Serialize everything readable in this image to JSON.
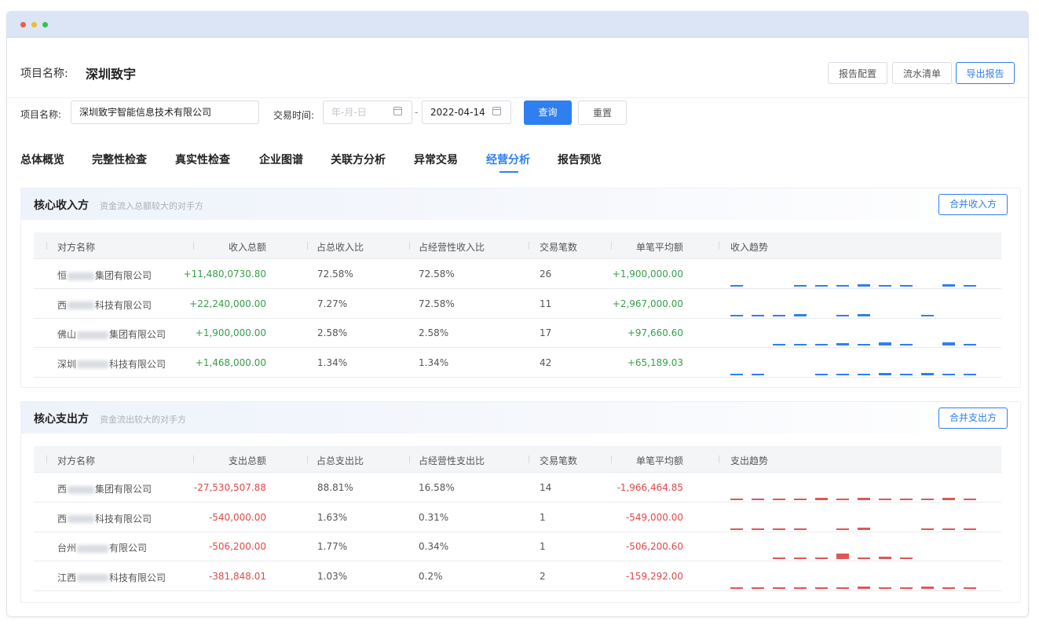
{
  "header": {
    "project_label": "项目名称:",
    "project_value": "深圳致宇",
    "buttons": [
      "报告配置",
      "流水清单",
      "导出报告"
    ]
  },
  "filters": {
    "project_label": "项目名称:",
    "project_value": "深圳致宇智能信息技术有限公司",
    "time_label": "交易时间:",
    "start_placeholder": "年-月-日",
    "end_value": "2022-04-14",
    "dash": "-",
    "query": "查询",
    "reset": "重置"
  },
  "tabs": [
    "总体概览",
    "完整性检查",
    "真实性检查",
    "企业图谱",
    "关联方分析",
    "异常交易",
    "经营分析",
    "报告预览"
  ],
  "active_tab": "经营分析",
  "income": {
    "title": "核心收入方",
    "subtitle": "资金流入总额较大的对手方",
    "merge": "合并收入方",
    "columns": [
      "对方名称",
      "收入总额",
      "占总收入比",
      "占经营性收入比",
      "交易笔数",
      "单笔平均额",
      "收入趋势"
    ],
    "rows": [
      {
        "name_pre": "恒",
        "name_post": "集团有限公司",
        "total": "+11,480,0730.80",
        "ratio_total": "72.58%",
        "ratio_op": "72.58%",
        "count": "26",
        "avg": "+1,900,000.00",
        "trend": [
          1,
          0,
          0,
          1,
          1,
          1,
          2,
          1,
          1,
          0,
          2,
          1
        ]
      },
      {
        "name_pre": "西",
        "name_post": "科技有限公司",
        "total": "+22,240,000.00",
        "ratio_total": "7.27%",
        "ratio_op": "72.58%",
        "count": "11",
        "avg": "+2,967,000.00",
        "trend": [
          1,
          1,
          1,
          2,
          0,
          1,
          2,
          0,
          0,
          1,
          0,
          0
        ]
      },
      {
        "name_pre": "佛山",
        "name_post": "集团有限公司",
        "total": "+1,900,000.00",
        "ratio_total": "2.58%",
        "ratio_op": "2.58%",
        "count": "17",
        "avg": "+97,660.60",
        "trend": [
          0,
          0,
          1,
          1,
          1,
          2,
          1,
          3,
          1,
          0,
          3,
          1
        ]
      },
      {
        "name_pre": "深圳",
        "name_post": "科技有限公司",
        "total": "+1,468,000.00",
        "ratio_total": "1.34%",
        "ratio_op": "1.34%",
        "count": "42",
        "avg": "+65,189.03",
        "trend": [
          1,
          1,
          0,
          0,
          1,
          1,
          1,
          2,
          1,
          2,
          1,
          1
        ]
      }
    ]
  },
  "expense": {
    "title": "核心支出方",
    "subtitle": "资金流出较大的对手方",
    "merge": "合并支出方",
    "columns": [
      "对方名称",
      "支出总额",
      "占总支出比",
      "占经营性支出比",
      "交易笔数",
      "单笔平均额",
      "支出趋势"
    ],
    "rows": [
      {
        "name_pre": "西",
        "name_post": "集团有限公司",
        "total": "-27,530,507.88",
        "ratio_total": "88.81%",
        "ratio_op": "16.58%",
        "count": "14",
        "avg": "-1,966,464.85",
        "trend": [
          1,
          1,
          1,
          1,
          2,
          1,
          2,
          1,
          1,
          1,
          2,
          1
        ]
      },
      {
        "name_pre": "西",
        "name_post": "科技有限公司",
        "total": "-540,000.00",
        "ratio_total": "1.63%",
        "ratio_op": "0.31%",
        "count": "1",
        "avg": "-549,000.00",
        "trend": [
          1,
          1,
          1,
          1,
          0,
          1,
          2,
          0,
          0,
          1,
          1,
          1
        ]
      },
      {
        "name_pre": "台州",
        "name_post": "有限公司",
        "total": "-506,200.00",
        "ratio_total": "1.77%",
        "ratio_op": "0.34%",
        "count": "1",
        "avg": "-506,200.60",
        "trend": [
          0,
          0,
          1,
          1,
          1,
          5,
          1,
          2,
          1,
          0,
          0,
          0
        ]
      },
      {
        "name_pre": "江西",
        "name_post": "科技有限公司",
        "total": "-381,848.01",
        "ratio_total": "1.03%",
        "ratio_op": "0.2%",
        "count": "2",
        "avg": "-159,292.00",
        "trend": [
          1,
          1,
          1,
          1,
          1,
          1,
          2,
          1,
          1,
          2,
          1,
          1
        ]
      }
    ]
  },
  "colors": {
    "accent": "#2f7ff0",
    "positive": "#35a04b",
    "negative": "#e34848",
    "income_bar": "#2f7ff0",
    "expense_bar": "#e05656"
  }
}
